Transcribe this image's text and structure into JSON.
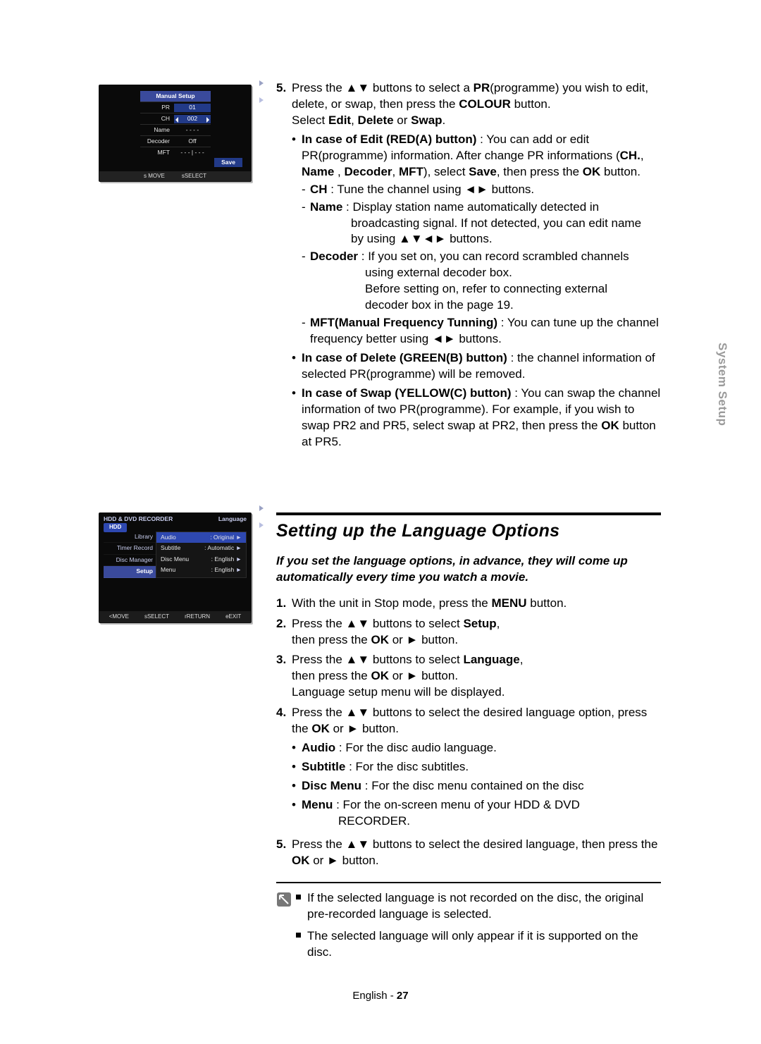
{
  "sidetab": "System Setup",
  "leftTop": {
    "title": "Manual Setup",
    "rows": {
      "pr": {
        "k": "PR",
        "v": "01"
      },
      "ch": {
        "k": "CH",
        "v": "002"
      },
      "name": {
        "k": "Name",
        "v": "- - - -"
      },
      "decoder": {
        "k": "Decoder",
        "v": "Off"
      },
      "mft": {
        "k": "MFT",
        "v": "- - - | - - -"
      }
    },
    "save": "Save",
    "foot": {
      "move": "s MOVE",
      "select": "sSELECT"
    }
  },
  "leftMid": {
    "header": {
      "device": "HDD & DVD RECORDER",
      "title": "Language"
    },
    "hdd": "HDD",
    "nav": [
      "Library",
      "Timer Record",
      "Disc Manager",
      "Setup"
    ],
    "opts": [
      {
        "k": "Audio",
        "v": ": Original"
      },
      {
        "k": "Subtitle",
        "v": ": Automatic"
      },
      {
        "k": "Disc Menu",
        "v": ": English"
      },
      {
        "k": "Menu",
        "v": ": English"
      }
    ],
    "foot": {
      "move": "<MOVE",
      "select": "sSELECT",
      "ret": "rRETURN",
      "exit": "eEXIT"
    }
  },
  "step5": {
    "num": "5.",
    "line1a": "Press the ",
    "line1b": " buttons to select a ",
    "line1c": "PR",
    "line1d": "(programme) you wish to edit, delete, or swap, then press the ",
    "line1e": "COLOUR",
    "line1f": " button.",
    "line2a": "Select ",
    "line2b": "Edit",
    "line2c": ", ",
    "line2d": "Delete",
    "line2e": " or ",
    "line2f": "Swap",
    "line2g": ".",
    "editHead": "In case of Edit (RED(A) button)",
    "editTail1": " : You can add or edit PR(programme) information. After change PR informations (",
    "editTail2": "CH.",
    "editTail3": ", ",
    "editTail4": "Name",
    "editTail5": " , ",
    "editTail6": "Decoder",
    "editTail7": ", ",
    "editTail8": "MFT",
    "editTail9": "), select ",
    "editTail10": "Save",
    "editTail11": ", then press the ",
    "editTail12": "OK",
    "editTail13": " button.",
    "chHead": "CH",
    "chTail": " : Tune the channel using ◄► buttons.",
    "nameHead": "Name",
    "nameTail": " : Display station name automatically detected in",
    "nameL2": "broadcasting signal. If not detected, you can edit name",
    "nameL3": "by using ▲▼◄► buttons.",
    "decHead": "Decoder",
    "decTail": " : If you set on, you can record scrambled channels",
    "decL2": "using external decoder box.",
    "decL3": "Before setting on, refer to connecting external",
    "decL4": "decoder box in the page 19.",
    "mftHead": "MFT(Manual Frequency Tunning)",
    "mftTail": " : You can tune up the channel frequency better using ◄► buttons.",
    "delHead": "In case of Delete (GREEN(B) button)",
    "delTail": " : the channel information of selected PR(programme) will be removed.",
    "swapHead": "In case of Swap (YELLOW(C) button)",
    "swapTail1": " : You can swap the channel information of two PR(programme). For example, if you wish to swap PR2 and PR5, select swap at PR2, then press the ",
    "swapTail2": "OK",
    "swapTail3": " button at PR5."
  },
  "section": {
    "title": "Setting up the Language Options",
    "lead": "If you set the language options, in advance, they will come up automatically every time you watch a movie.",
    "s1": {
      "num": "1.",
      "a": "With the unit in Stop mode, press the ",
      "b": "MENU",
      "c": " button."
    },
    "s2": {
      "num": "2.",
      "a": "Press the ▲▼ buttons to select ",
      "b": "Setup",
      "c": ",",
      "d": "then press the ",
      "e": "OK",
      "f": " or ► button."
    },
    "s3": {
      "num": "3.",
      "a": "Press the ▲▼ buttons to select ",
      "b": "Language",
      "c": ",",
      "d": "then press the ",
      "e": "OK",
      "f": " or ► button.",
      "g": "Language setup menu will be displayed."
    },
    "s4": {
      "num": "4.",
      "a": "Press the ▲▼ buttons to select the desired language option, press the ",
      "b": "OK",
      "c": " or ► button.",
      "audioH": "Audio",
      "audioT": " : For the disc audio language.",
      "subH": "Subtitle",
      "subT": " : For the disc subtitles.",
      "dmH": "Disc Menu",
      "dmT": " : For the disc menu contained on the disc",
      "menuH": "Menu",
      "menuT": " : For the on-screen menu of your HDD & DVD",
      "menuT2": "RECORDER."
    },
    "s5": {
      "num": "5.",
      "a": "Press the ▲▼ buttons to select the desired language, then press the ",
      "b": "OK",
      "c": " or ► button."
    }
  },
  "note": {
    "l1": "If the selected language is not recorded on the disc, the original pre-recorded language is selected.",
    "l2": "The selected language will only appear if it is supported on the disc."
  },
  "footer": {
    "lang": "English",
    "sep": " - ",
    "page": "27"
  },
  "glyph": {
    "ud": "▲▼"
  }
}
